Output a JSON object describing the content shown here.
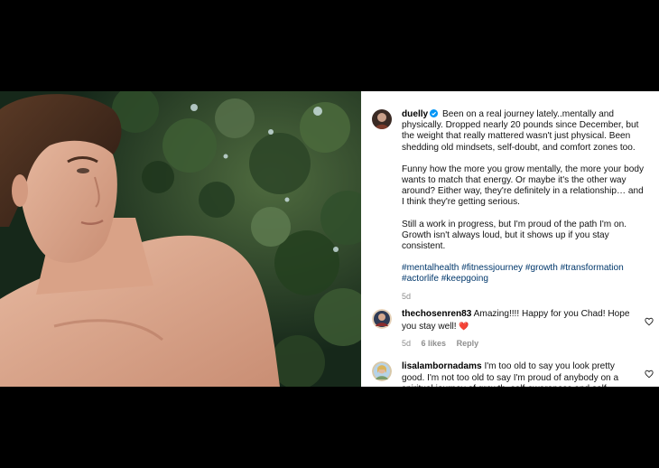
{
  "post": {
    "username": "duelly",
    "caption_paragraphs": [
      "Been on a real journey lately..mentally and physically. Dropped nearly 20 pounds since December, but the weight that really mattered wasn't just physical. Been shedding old mindsets, self-doubt, and comfort zones too.",
      "Funny how the more you grow mentally, the more your body wants to match that energy. Or maybe it's the other way around? Either way, they're definitely in a relationship… and I think they're getting serious.",
      "Still a work in progress, but I'm proud of the path I'm on. Growth isn't always loud, but it shows up if you stay consistent."
    ],
    "hashtags": "#mentalhealth #fitnessjourney #growth #transformation #actorlife #keepgoing",
    "time": "5d"
  },
  "comments": [
    {
      "username": "thechosenren83",
      "text": "Amazing!!!! Happy for you Chad! Hope you stay well!",
      "emoji": "❤️",
      "time": "5d",
      "likes": "6 likes",
      "reply": "Reply"
    },
    {
      "username": "lisalambornadams",
      "text": "I'm too old to say you look pretty good. I'm not too old to say I'm proud of anybody on a spiritual journey of growth, self-awareness and self-confidence. Keep going!"
    }
  ],
  "icons": {
    "verified": "verified-badge-icon",
    "like": "heart-outline-icon"
  },
  "colors": {
    "link": "#00376b",
    "muted": "#8e8e8e",
    "verified": "#0095f6"
  }
}
